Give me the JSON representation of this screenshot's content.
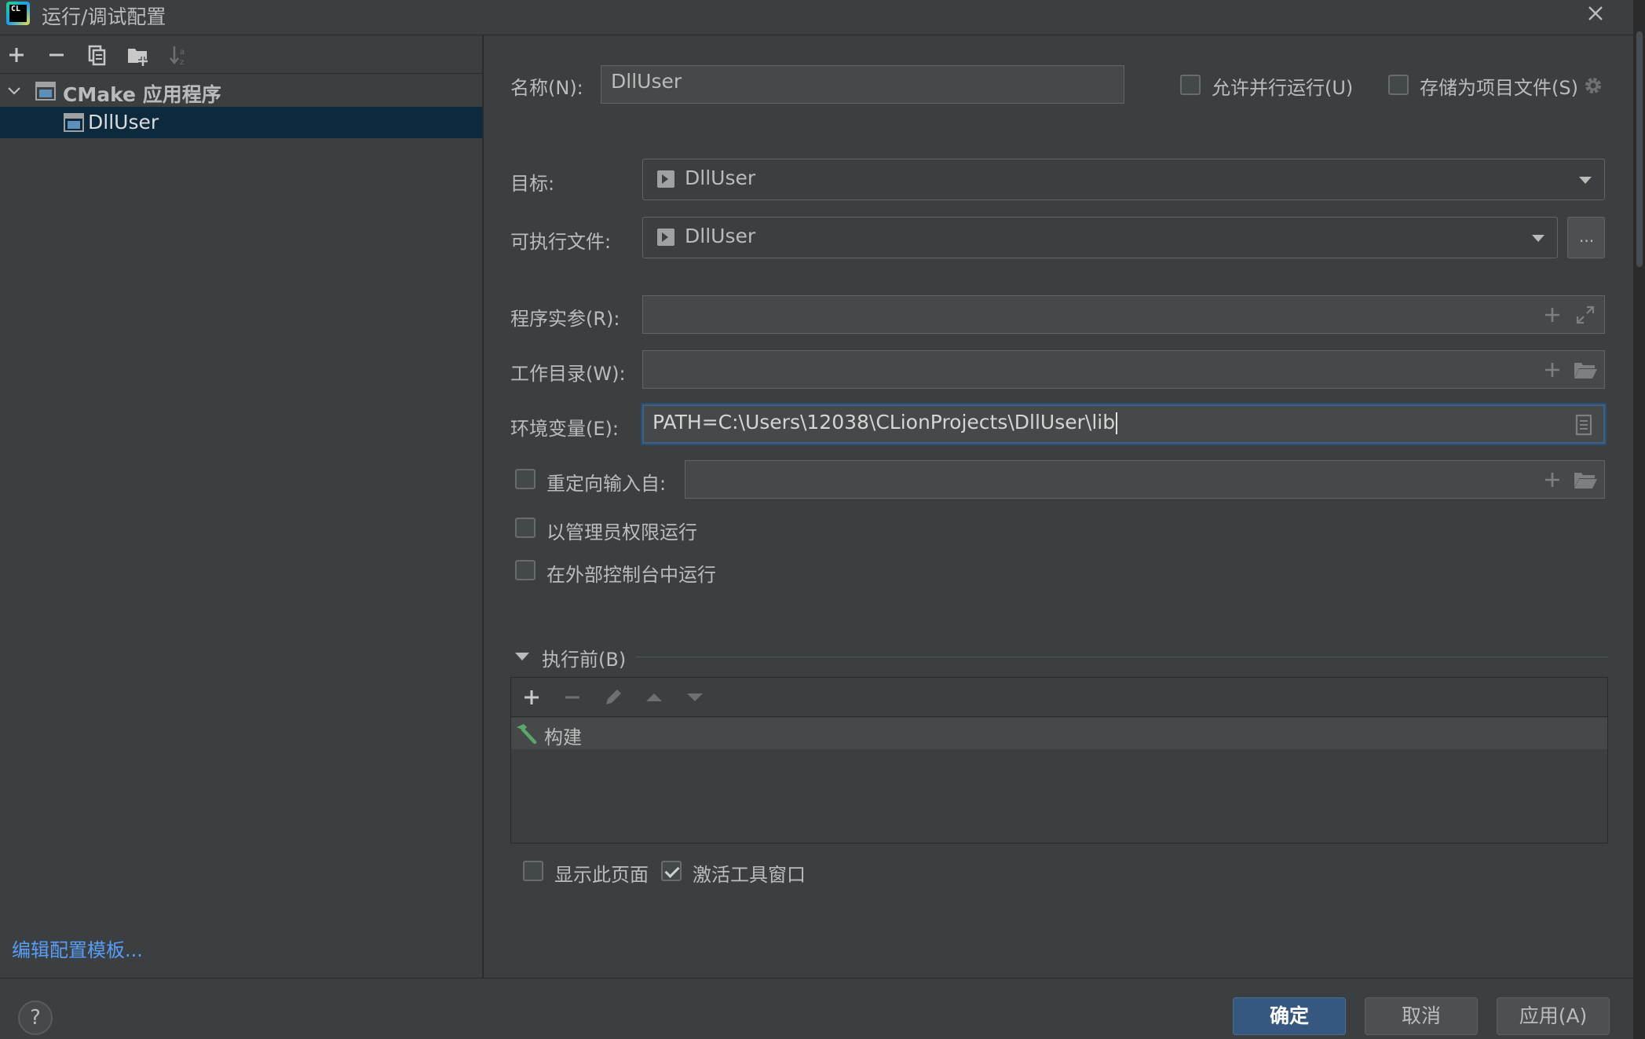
{
  "window": {
    "title": "运行/调试配置"
  },
  "tree": {
    "root_label": "CMake 应用程序",
    "child_label": "DllUser"
  },
  "edit_templates": "编辑配置模板...",
  "form": {
    "name_label": "名称(N):",
    "name_value": "DllUser",
    "allow_parallel": "允许并行运行(U)",
    "store_as_project": "存储为项目文件(S)",
    "target_label": "目标:",
    "target_value": "DllUser",
    "exe_label": "可执行文件:",
    "exe_value": "DllUser",
    "browse_label": "...",
    "args_label": "程序实参(R):",
    "args_value": "",
    "workdir_label": "工作目录(W):",
    "workdir_value": "",
    "env_label": "环境变量(E):",
    "env_value": "PATH=C:\\Users\\12038\\CLionProjects\\DllUser\\lib",
    "redirect_label": "重定向输入自:",
    "redirect_value": "",
    "admin_label": "以管理员权限运行",
    "external_console_label": "在外部控制台中运行"
  },
  "before_launch": {
    "title": "执行前(B)",
    "items": [
      "构建"
    ],
    "show_page": "显示此页面",
    "show_page_checked": false,
    "activate_tool_window": "激活工具窗口",
    "activate_tool_window_checked": true
  },
  "buttons": {
    "ok": "确定",
    "cancel": "取消",
    "apply": "应用(A)",
    "help": "?"
  },
  "colors": {
    "background": "#3c3f41",
    "selection": "#0d293e",
    "primary_button": "#365880",
    "link": "#589df6",
    "build_icon": "#59a869"
  }
}
